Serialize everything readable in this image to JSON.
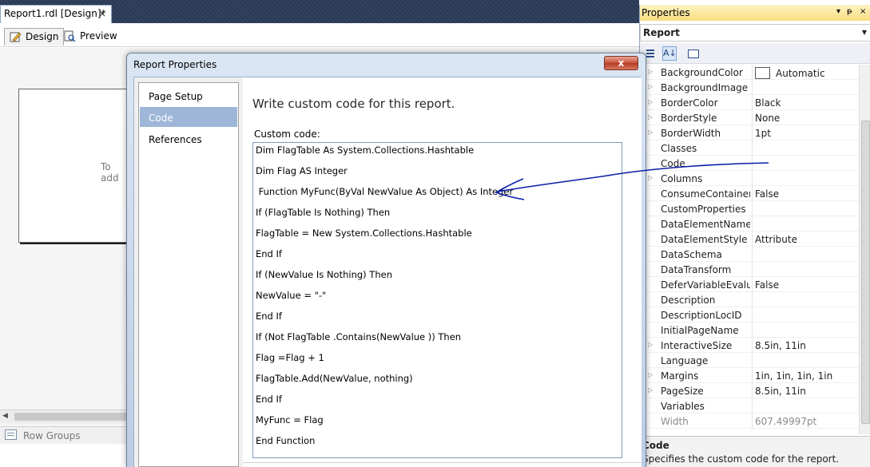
{
  "document_tab": {
    "title": "Report1.rdl [Design]*",
    "close": "×"
  },
  "view_tabs": {
    "design": "Design",
    "preview": "Preview"
  },
  "canvas": {
    "placeholder": "To add"
  },
  "groups": {
    "row_groups": "Row Groups"
  },
  "properties": {
    "title": "Properties",
    "pin": "ᵽ",
    "close": "×",
    "dropdown": "▾",
    "object": "Report",
    "rows": [
      {
        "name": "BackgroundColor",
        "value": "Automatic",
        "expandable": true,
        "swatch": "#ffffff"
      },
      {
        "name": "BackgroundImage",
        "value": "",
        "expandable": true
      },
      {
        "name": "BorderColor",
        "value": "Black",
        "expandable": true
      },
      {
        "name": "BorderStyle",
        "value": "None",
        "expandable": true
      },
      {
        "name": "BorderWidth",
        "value": "1pt",
        "expandable": true
      },
      {
        "name": "Classes",
        "value": "",
        "expandable": false
      },
      {
        "name": "Code",
        "value": "",
        "expandable": false
      },
      {
        "name": "Columns",
        "value": "",
        "expandable": true
      },
      {
        "name": "ConsumeContainerW",
        "value": "False",
        "expandable": false
      },
      {
        "name": "CustomProperties",
        "value": "",
        "expandable": false
      },
      {
        "name": "DataElementName",
        "value": "",
        "expandable": false
      },
      {
        "name": "DataElementStyle",
        "value": "Attribute",
        "expandable": false
      },
      {
        "name": "DataSchema",
        "value": "",
        "expandable": false
      },
      {
        "name": "DataTransform",
        "value": "",
        "expandable": false
      },
      {
        "name": "DeferVariableEvaluati",
        "value": "False",
        "expandable": false
      },
      {
        "name": "Description",
        "value": "",
        "expandable": false
      },
      {
        "name": "DescriptionLocID",
        "value": "",
        "expandable": false
      },
      {
        "name": "InitialPageName",
        "value": "",
        "expandable": false
      },
      {
        "name": "InteractiveSize",
        "value": "8.5in, 11in",
        "expandable": true
      },
      {
        "name": "Language",
        "value": "",
        "expandable": false
      },
      {
        "name": "Margins",
        "value": "1in, 1in, 1in, 1in",
        "expandable": true
      },
      {
        "name": "PageSize",
        "value": "8.5in, 11in",
        "expandable": true
      },
      {
        "name": "Variables",
        "value": "",
        "expandable": false
      },
      {
        "name": "Width",
        "value": "607.49997pt",
        "expandable": false,
        "dim": true
      }
    ],
    "description_title": "Code",
    "description_text": "Specifies the custom code for the report."
  },
  "dialog": {
    "title": "Report Properties",
    "close": "x",
    "nav": [
      "Page Setup",
      "Code",
      "References"
    ],
    "selected_nav": 1,
    "heading": "Write custom code for this report.",
    "code_label": "Custom code:",
    "code_lines": [
      "Dim FlagTable As System.Collections.Hashtable",
      "Dim Flag AS Integer",
      " Function MyFunc(ByVal NewValue As Object) As Integer",
      "If (FlagTable Is Nothing) Then",
      "FlagTable = New System.Collections.Hashtable",
      "End If",
      "If (NewValue Is Nothing) Then",
      "NewValue = \"-\"",
      "End If",
      "If (Not FlagTable .Contains(NewValue )) Then",
      "Flag =Flag + 1",
      "FlagTable.Add(NewValue, nothing)",
      "End If",
      "MyFunc = Flag",
      "End Function"
    ]
  },
  "colors": {
    "accent": "#0b1fa8",
    "title_bar": "#293955",
    "selection": "#9eb6d7"
  }
}
